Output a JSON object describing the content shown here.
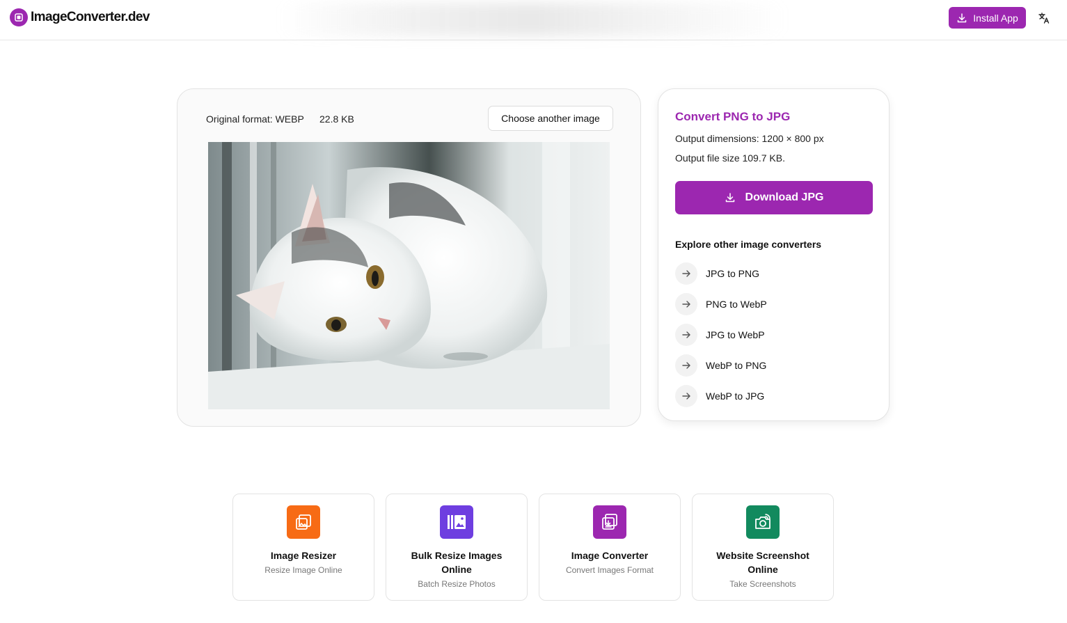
{
  "header": {
    "logo_text": "ImageConverter.dev",
    "install_label": "Install App"
  },
  "image_panel": {
    "original_format": "Original format: WEBP",
    "file_size": "22.8 KB",
    "choose_label": "Choose another image"
  },
  "info_panel": {
    "title": "Convert PNG to JPG",
    "output_dimensions": "Output dimensions: 1200 × 800 px",
    "output_size": "Output file size 109.7 KB.",
    "download_label": "Download JPG",
    "explore_title": "Explore other image converters",
    "converters": [
      {
        "label": "JPG to PNG"
      },
      {
        "label": "PNG to WebP"
      },
      {
        "label": "JPG to WebP"
      },
      {
        "label": "WebP to PNG"
      },
      {
        "label": "WebP to JPG"
      }
    ]
  },
  "tools": [
    {
      "name": "Image Resizer",
      "sub": "Resize Image Online",
      "color": "#f76b15",
      "icon": "image-resize-icon"
    },
    {
      "name": "Bulk Resize Images Online",
      "sub": "Batch Resize Photos",
      "color": "#6e3ee0",
      "icon": "bulk-resize-icon"
    },
    {
      "name": "Image Converter",
      "sub": "Convert Images Format",
      "color": "#9c27b0",
      "icon": "image-convert-icon"
    },
    {
      "name": "Website Screenshot Online",
      "sub": "Take Screenshots",
      "color": "#128a5e",
      "icon": "camera-icon"
    }
  ],
  "colors": {
    "accent": "#9c27b0"
  }
}
